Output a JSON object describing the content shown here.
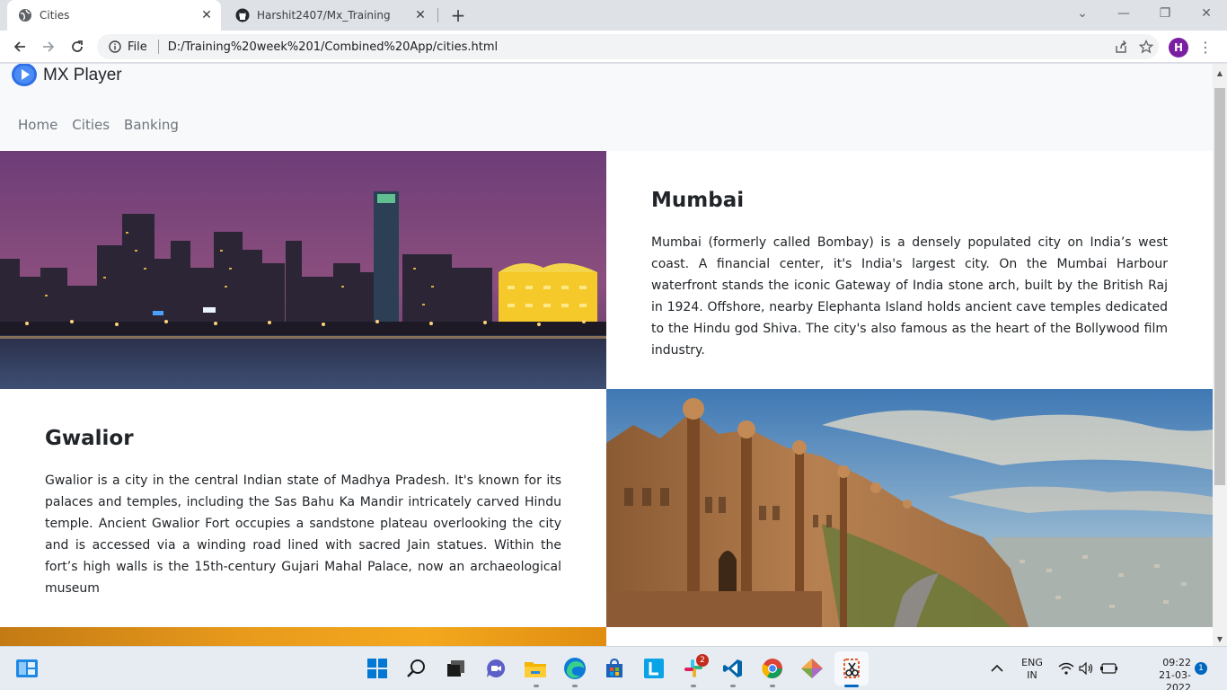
{
  "browser": {
    "tabs": [
      {
        "title": "Cities",
        "active": true,
        "icon": "globe-icon"
      },
      {
        "title": "Harshit2407/Mx_Training",
        "active": false,
        "icon": "github-icon"
      }
    ],
    "scheme_label": "File",
    "url": "D:/Training%20week%201/Combined%20App/cities.html",
    "profile_initial": "H",
    "profile_color": "#7b1fa2"
  },
  "site": {
    "brand": "MX Player",
    "nav": [
      "Home",
      "Cities",
      "Banking"
    ]
  },
  "cities": [
    {
      "name": "Mumbai",
      "description": "Mumbai (formerly called Bombay) is a densely populated city on India’s west coast. A financial center, it's India's largest city. On the Mumbai Harbour waterfront stands the iconic Gateway of India stone arch, built by the British Raj in 1924. Offshore, nearby Elephanta Island holds ancient cave temples dedicated to the Hindu god Shiva. The city's also famous as the heart of the Bollywood film industry.",
      "image": "mumbai-skyline-night"
    },
    {
      "name": "Gwalior",
      "description": "Gwalior is a city in the central Indian state of Madhya Pradesh. It's known for its palaces and temples, including the Sas Bahu Ka Mandir intricately carved Hindu temple. Ancient Gwalior Fort occupies a sandstone plateau overlooking the city and is accessed via a winding road lined with sacred Jain statues. Within the fort’s high walls is the 15th-century Gujari Mahal Palace, now an archaeological museum",
      "image": "gwalior-fort"
    }
  ],
  "taskbar": {
    "apps": [
      "start-icon",
      "search-icon",
      "task-view-icon",
      "chat-icon",
      "file-explorer-icon",
      "edge-icon",
      "store-icon",
      "l-app-icon",
      "slack-icon",
      "vscode-icon",
      "chrome-icon",
      "git-icon",
      "snipping-tool-icon"
    ],
    "slack_badge": "2",
    "language": "ENG",
    "region": "IN",
    "time": "09:22",
    "date": "21-03-2022",
    "notifications": "1"
  }
}
